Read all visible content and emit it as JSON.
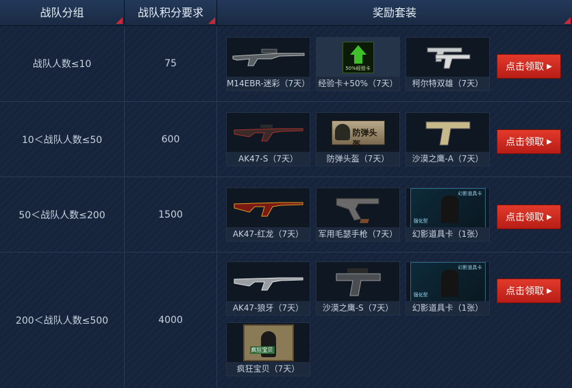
{
  "headers": {
    "group": "战队分组",
    "points": "战队积分要求",
    "rewards": "奖励套装"
  },
  "claim_button": "点击领取",
  "accent_color": "#c8283a",
  "rows": [
    {
      "group": "战队人数≤10",
      "points": "75",
      "items": [
        {
          "label": "M14EBR-迷彩（7天）",
          "icon": "rifle-m14ebr-camo-icon"
        },
        {
          "label": "经验卡+50%（7天）",
          "icon": "exp-card-icon",
          "badge_text": "50%经验卡"
        },
        {
          "label": "柯尔特双雄（7天）",
          "icon": "colt-dual-pistols-icon"
        }
      ]
    },
    {
      "group": "10＜战队人数≤50",
      "points": "600",
      "items": [
        {
          "label": "AK47-S（7天）",
          "icon": "rifle-ak47-s-icon"
        },
        {
          "label": "防弹头盔（7天）",
          "icon": "helmet-icon",
          "badge_text": "防弹头盔"
        },
        {
          "label": "沙漠之鹰-A（7天）",
          "icon": "desert-eagle-a-icon"
        }
      ]
    },
    {
      "group": "50＜战队人数≤200",
      "points": "1500",
      "items": [
        {
          "label": "AK47-红龙（7天）",
          "icon": "rifle-ak47-red-dragon-icon"
        },
        {
          "label": "军用毛瑟手枪（7天）",
          "icon": "mauser-pistol-icon"
        },
        {
          "label": "幻影道具卡（1张）",
          "icon": "phantom-item-card-icon",
          "badge_text": "幻影道具卡",
          "badge_sub": "强化型"
        }
      ]
    },
    {
      "group": "200＜战队人数≤500",
      "points": "4000",
      "items": [
        {
          "label": "AK47-狼牙（7天）",
          "icon": "rifle-ak47-wolf-fang-icon"
        },
        {
          "label": "沙漠之鹰-S（7天）",
          "icon": "desert-eagle-s-icon"
        },
        {
          "label": "幻影道具卡（1张）",
          "icon": "phantom-item-card-icon",
          "badge_text": "幻影道具卡",
          "badge_sub": "强化型"
        },
        {
          "label": "疯狂宝贝（7天）",
          "icon": "crazy-baby-character-icon",
          "badge_text": "疯狂宝贝"
        }
      ]
    }
  ]
}
